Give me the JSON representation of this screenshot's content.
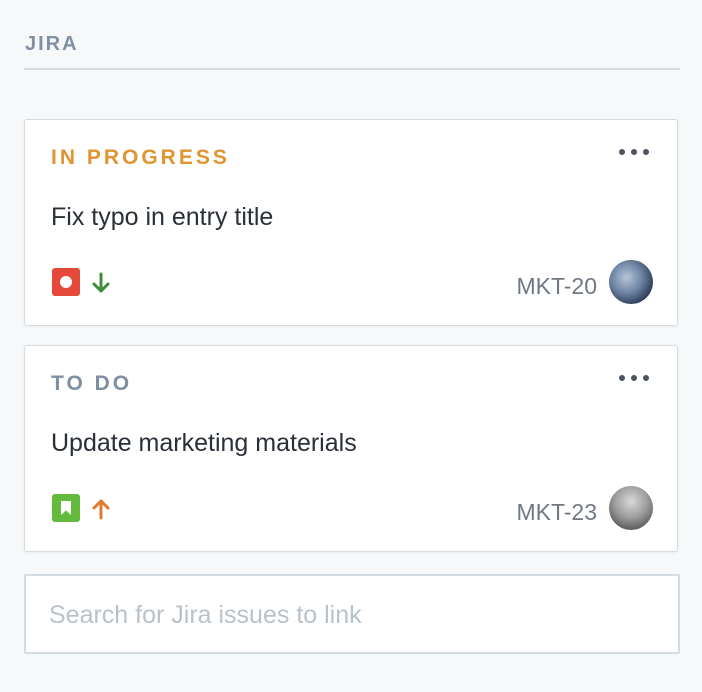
{
  "section": {
    "title": "JIRA"
  },
  "issues": [
    {
      "status": "IN PROGRESS",
      "status_color": "#e09531",
      "title": "Fix typo in entry title",
      "type_icon": "bug-icon",
      "type_color": "#e5493a",
      "priority_icon": "arrow-down-icon",
      "priority_color": "#3d8c3a",
      "key": "MKT-20",
      "avatar": "avatar"
    },
    {
      "status": "TO DO",
      "status_color": "#7f8ea0",
      "title": "Update marketing materials",
      "type_icon": "bookmark-icon",
      "type_color": "#63ba3c",
      "priority_icon": "arrow-up-icon",
      "priority_color": "#e07a2f",
      "key": "MKT-23",
      "avatar": "avatar"
    }
  ],
  "search": {
    "placeholder": "Search for Jira issues to link",
    "value": ""
  }
}
